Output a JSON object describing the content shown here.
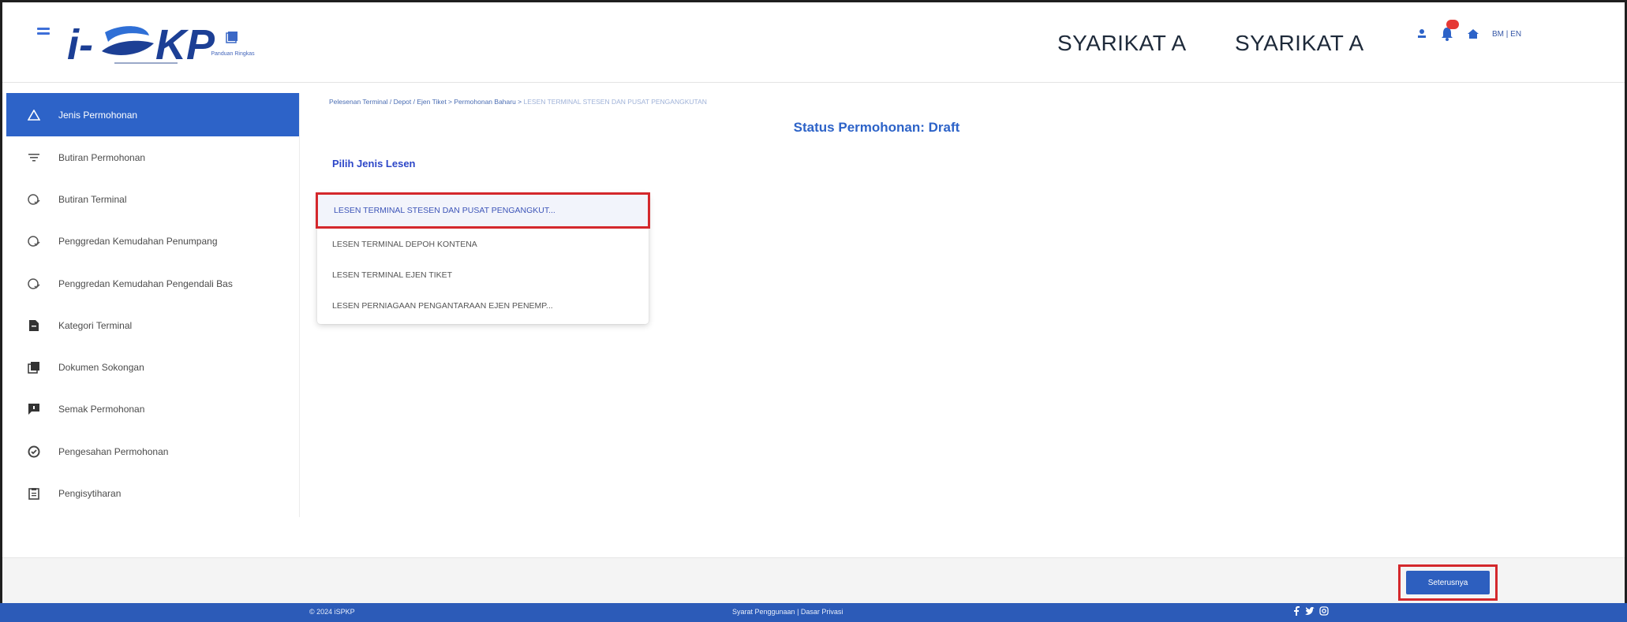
{
  "header": {
    "logo_text": "i-SPKP",
    "panduan_label": "Panduan Ringkas",
    "company_names": [
      "SYARIKAT A",
      "SYARIKAT A"
    ],
    "language": "BM | EN"
  },
  "sidebar": {
    "items": [
      {
        "label": "Jenis Permohonan",
        "icon": "warning-icon",
        "active": true
      },
      {
        "label": "Butiran Permohonan",
        "icon": "filter-icon"
      },
      {
        "label": "Butiran Terminal",
        "icon": "check-circle-icon"
      },
      {
        "label": "Penggredan Kemudahan Penumpang",
        "icon": "check-circle-icon"
      },
      {
        "label": "Penggredan Kemudahan Pengendali Bas",
        "icon": "check-circle-icon"
      },
      {
        "label": "Kategori Terminal",
        "icon": "document-icon"
      },
      {
        "label": "Dokumen Sokongan",
        "icon": "stacked-documents-icon"
      },
      {
        "label": "Semak Permohonan",
        "icon": "comment-icon"
      },
      {
        "label": "Pengesahan Permohonan",
        "icon": "verified-icon"
      },
      {
        "label": "Pengisytiharan",
        "icon": "clipboard-icon"
      }
    ]
  },
  "main": {
    "breadcrumb": "Pelesenan Terminal / Depot / Ejen Tiket > Permohonan Baharu > ",
    "breadcrumb_current": "LESEN TERMINAL STESEN DAN PUSAT PENGANGKUTAN",
    "status_title": "Status Permohonan: Draft",
    "section_label": "Pilih Jenis Lesen",
    "license_options": [
      "LESEN TERMINAL STESEN DAN PUSAT PENGANGKUT...",
      "LESEN TERMINAL DEPOH KONTENA",
      "LESEN TERMINAL EJEN TIKET",
      "LESEN PERNIAGAAN PENGANTARAAN EJEN PENEMP..."
    ],
    "selected_index": 0
  },
  "actions": {
    "next_label": "Seterusnya"
  },
  "footer": {
    "copyright": "© 2024 iSPKP",
    "links": "Syarat Penggunaan | Dasar Privasi"
  },
  "colors": {
    "primary": "#2d63c8",
    "highlight": "#d4282c",
    "footer": "#2c5bb8"
  }
}
